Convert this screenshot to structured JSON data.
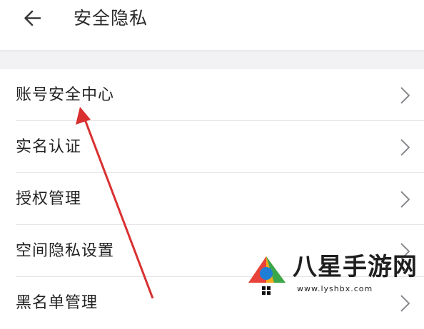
{
  "header": {
    "title": "安全隐私",
    "back_icon": "arrow-left-icon"
  },
  "settings": {
    "items": [
      {
        "label": "账号安全中心",
        "icon": "chevron-right-icon"
      },
      {
        "label": "实名认证",
        "icon": "chevron-right-icon"
      },
      {
        "label": "授权管理",
        "icon": "chevron-right-icon"
      },
      {
        "label": "空间隐私设置",
        "icon": "chevron-right-icon"
      },
      {
        "label": "黑名单管理",
        "icon": "chevron-right-icon"
      }
    ]
  },
  "annotation": {
    "arrow_color": "#d93030",
    "target": "账号安全中心"
  },
  "watermark": {
    "text": "八星手游网",
    "url": "www.lyshbx.com"
  },
  "colors": {
    "background": "#ffffff",
    "section_band": "#f2f2f4",
    "divider": "#e3e3e6",
    "text": "#222222",
    "chevron": "#8a8a8f"
  }
}
